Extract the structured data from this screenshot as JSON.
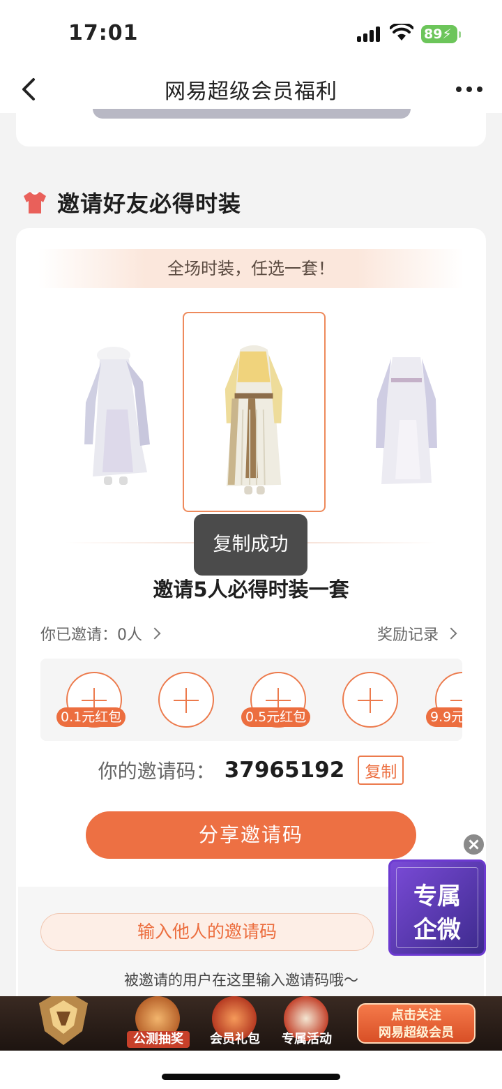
{
  "status": {
    "time": "17:01",
    "battery": "89"
  },
  "nav": {
    "title": "网易超级会员福利"
  },
  "section": {
    "title": "邀请好友必得时装",
    "icon": "tshirt-icon"
  },
  "banner": {
    "text": "全场时装，任选一套！"
  },
  "toast": {
    "text": "复制成功"
  },
  "invite": {
    "headline": "邀请5人必得时装一套",
    "invited_label": "你已邀请：0人",
    "reward_record_label": "奖励记录",
    "slots": [
      {
        "tag": "0.1元红包"
      },
      {
        "tag": ""
      },
      {
        "tag": "0.5元红包"
      },
      {
        "tag": ""
      },
      {
        "tag": "9.9元"
      }
    ],
    "code_label": "你的邀请码：",
    "code_value": "37965192",
    "copy_label": "复制",
    "share_label": "分享邀请码"
  },
  "enter": {
    "placeholder": "输入他人的邀请码",
    "hint": "被邀请的用户在这里输入邀请码哦～"
  },
  "float_widget": {
    "line1": "专属",
    "line2": "企微"
  },
  "promo": {
    "items": [
      {
        "label": "公测抽奖"
      },
      {
        "label": "会员礼包"
      },
      {
        "label": "专属活动"
      }
    ],
    "cta_line1": "点击关注",
    "cta_line2": "网易超级会员"
  },
  "colors": {
    "accent": "#ed7043",
    "toast_bg": "#4b4b4b",
    "battery": "#6cc55a"
  }
}
